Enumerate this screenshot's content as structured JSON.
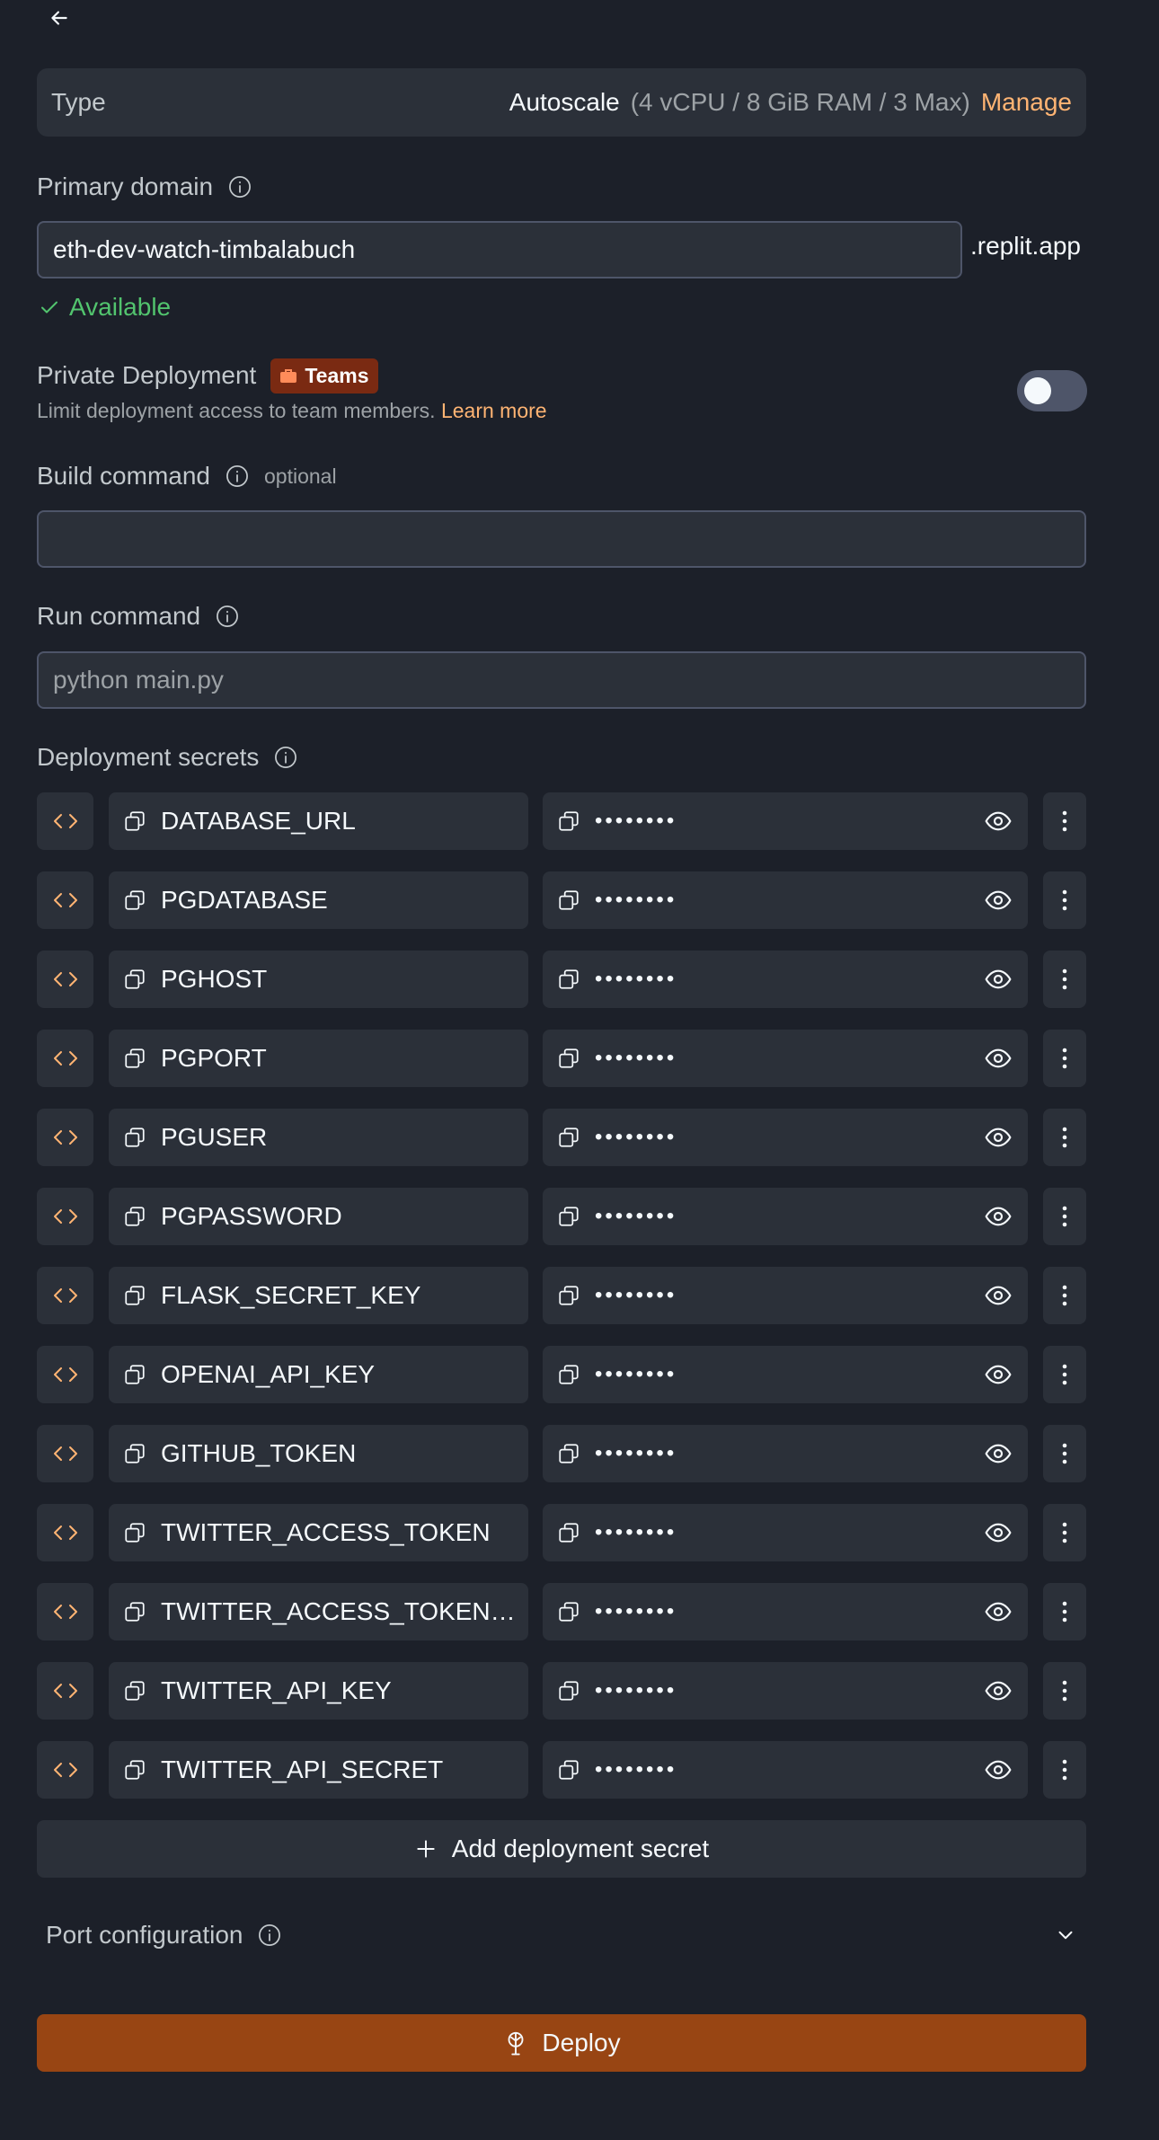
{
  "type_card": {
    "label": "Type",
    "value": "Autoscale",
    "spec": "(4 vCPU / 8 GiB RAM / 3 Max)",
    "manage": "Manage"
  },
  "primary_domain": {
    "label": "Primary domain",
    "value": "eth-dev-watch-timbalabuch",
    "suffix": ".replit.app",
    "status": "Available"
  },
  "private_deployment": {
    "label": "Private Deployment",
    "badge": "Teams",
    "description": "Limit deployment access to team members.",
    "learn_more": "Learn more",
    "enabled": false
  },
  "build_command": {
    "label": "Build command",
    "optional": "optional",
    "value": ""
  },
  "run_command": {
    "label": "Run command",
    "placeholder": "python main.py"
  },
  "deployment_secrets": {
    "label": "Deployment secrets",
    "masked": "••••••••",
    "items": [
      "DATABASE_URL",
      "PGDATABASE",
      "PGHOST",
      "PGPORT",
      "PGUSER",
      "PGPASSWORD",
      "FLASK_SECRET_KEY",
      "OPENAI_API_KEY",
      "GITHUB_TOKEN",
      "TWITTER_ACCESS_TOKEN",
      "TWITTER_ACCESS_TOKEN_S...",
      "TWITTER_API_KEY",
      "TWITTER_API_SECRET"
    ],
    "add_label": "Add deployment secret"
  },
  "port_configuration": {
    "label": "Port configuration"
  },
  "deploy": {
    "label": "Deploy"
  },
  "colors": {
    "background": "#1c2029",
    "surface": "#2b3039",
    "accent_orange": "#ffb473",
    "deploy_button": "#984513",
    "success": "#52c46e"
  }
}
